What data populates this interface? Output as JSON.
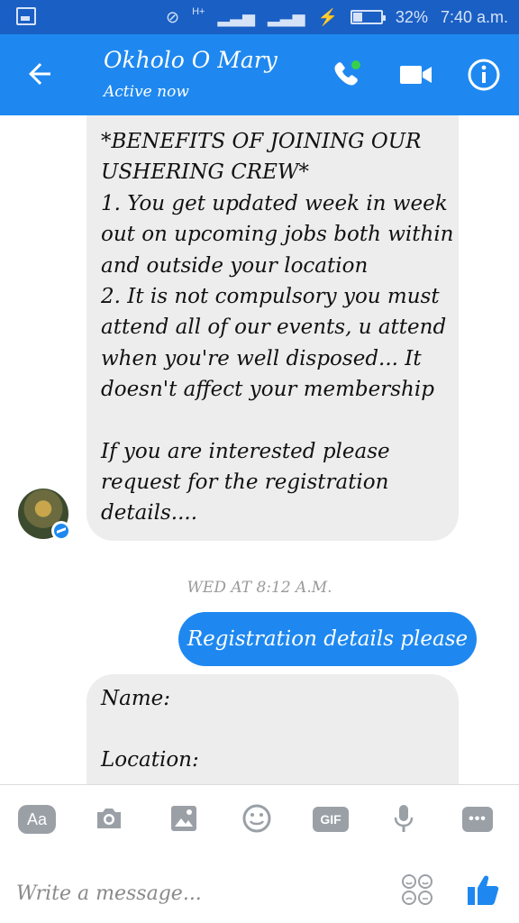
{
  "status_bar": {
    "network_label": "H+",
    "battery_percent": "32%",
    "battery_level": 0.32,
    "time": "7:40 a.m."
  },
  "header": {
    "contact_name": "Okholo O Mary",
    "contact_status": "Active now",
    "accent_color": "#1e88f0"
  },
  "messages": {
    "incoming_1": {
      "lines": [
        "*BENEFITS OF JOINING OUR",
        "USHERING CREW*",
        "1. You get updated week in week",
        "out on upcoming jobs both within",
        "and outside your location",
        "2. It is not compulsory you must",
        "attend all of our events, u attend",
        "when you're well disposed... It",
        "doesn't affect your membership",
        "",
        "If you are interested please",
        "request for the registration",
        "details...."
      ]
    },
    "timestamp": "WED AT 8:12 A.M.",
    "outgoing_1": "Registration details please",
    "incoming_2": {
      "lines": [
        "Name:",
        "",
        "Location:"
      ]
    }
  },
  "composer": {
    "aa_label": "Aa",
    "gif_label": "GIF",
    "more_label": "•••",
    "placeholder": "Write a message..."
  },
  "icons": [
    "back-arrow-icon",
    "phone-icon",
    "video-camera-icon",
    "info-icon",
    "camera-icon",
    "image-icon",
    "emoji-icon",
    "microphone-icon",
    "emoji-grid-icon",
    "thumbs-up-icon",
    "messenger-badge-icon"
  ]
}
